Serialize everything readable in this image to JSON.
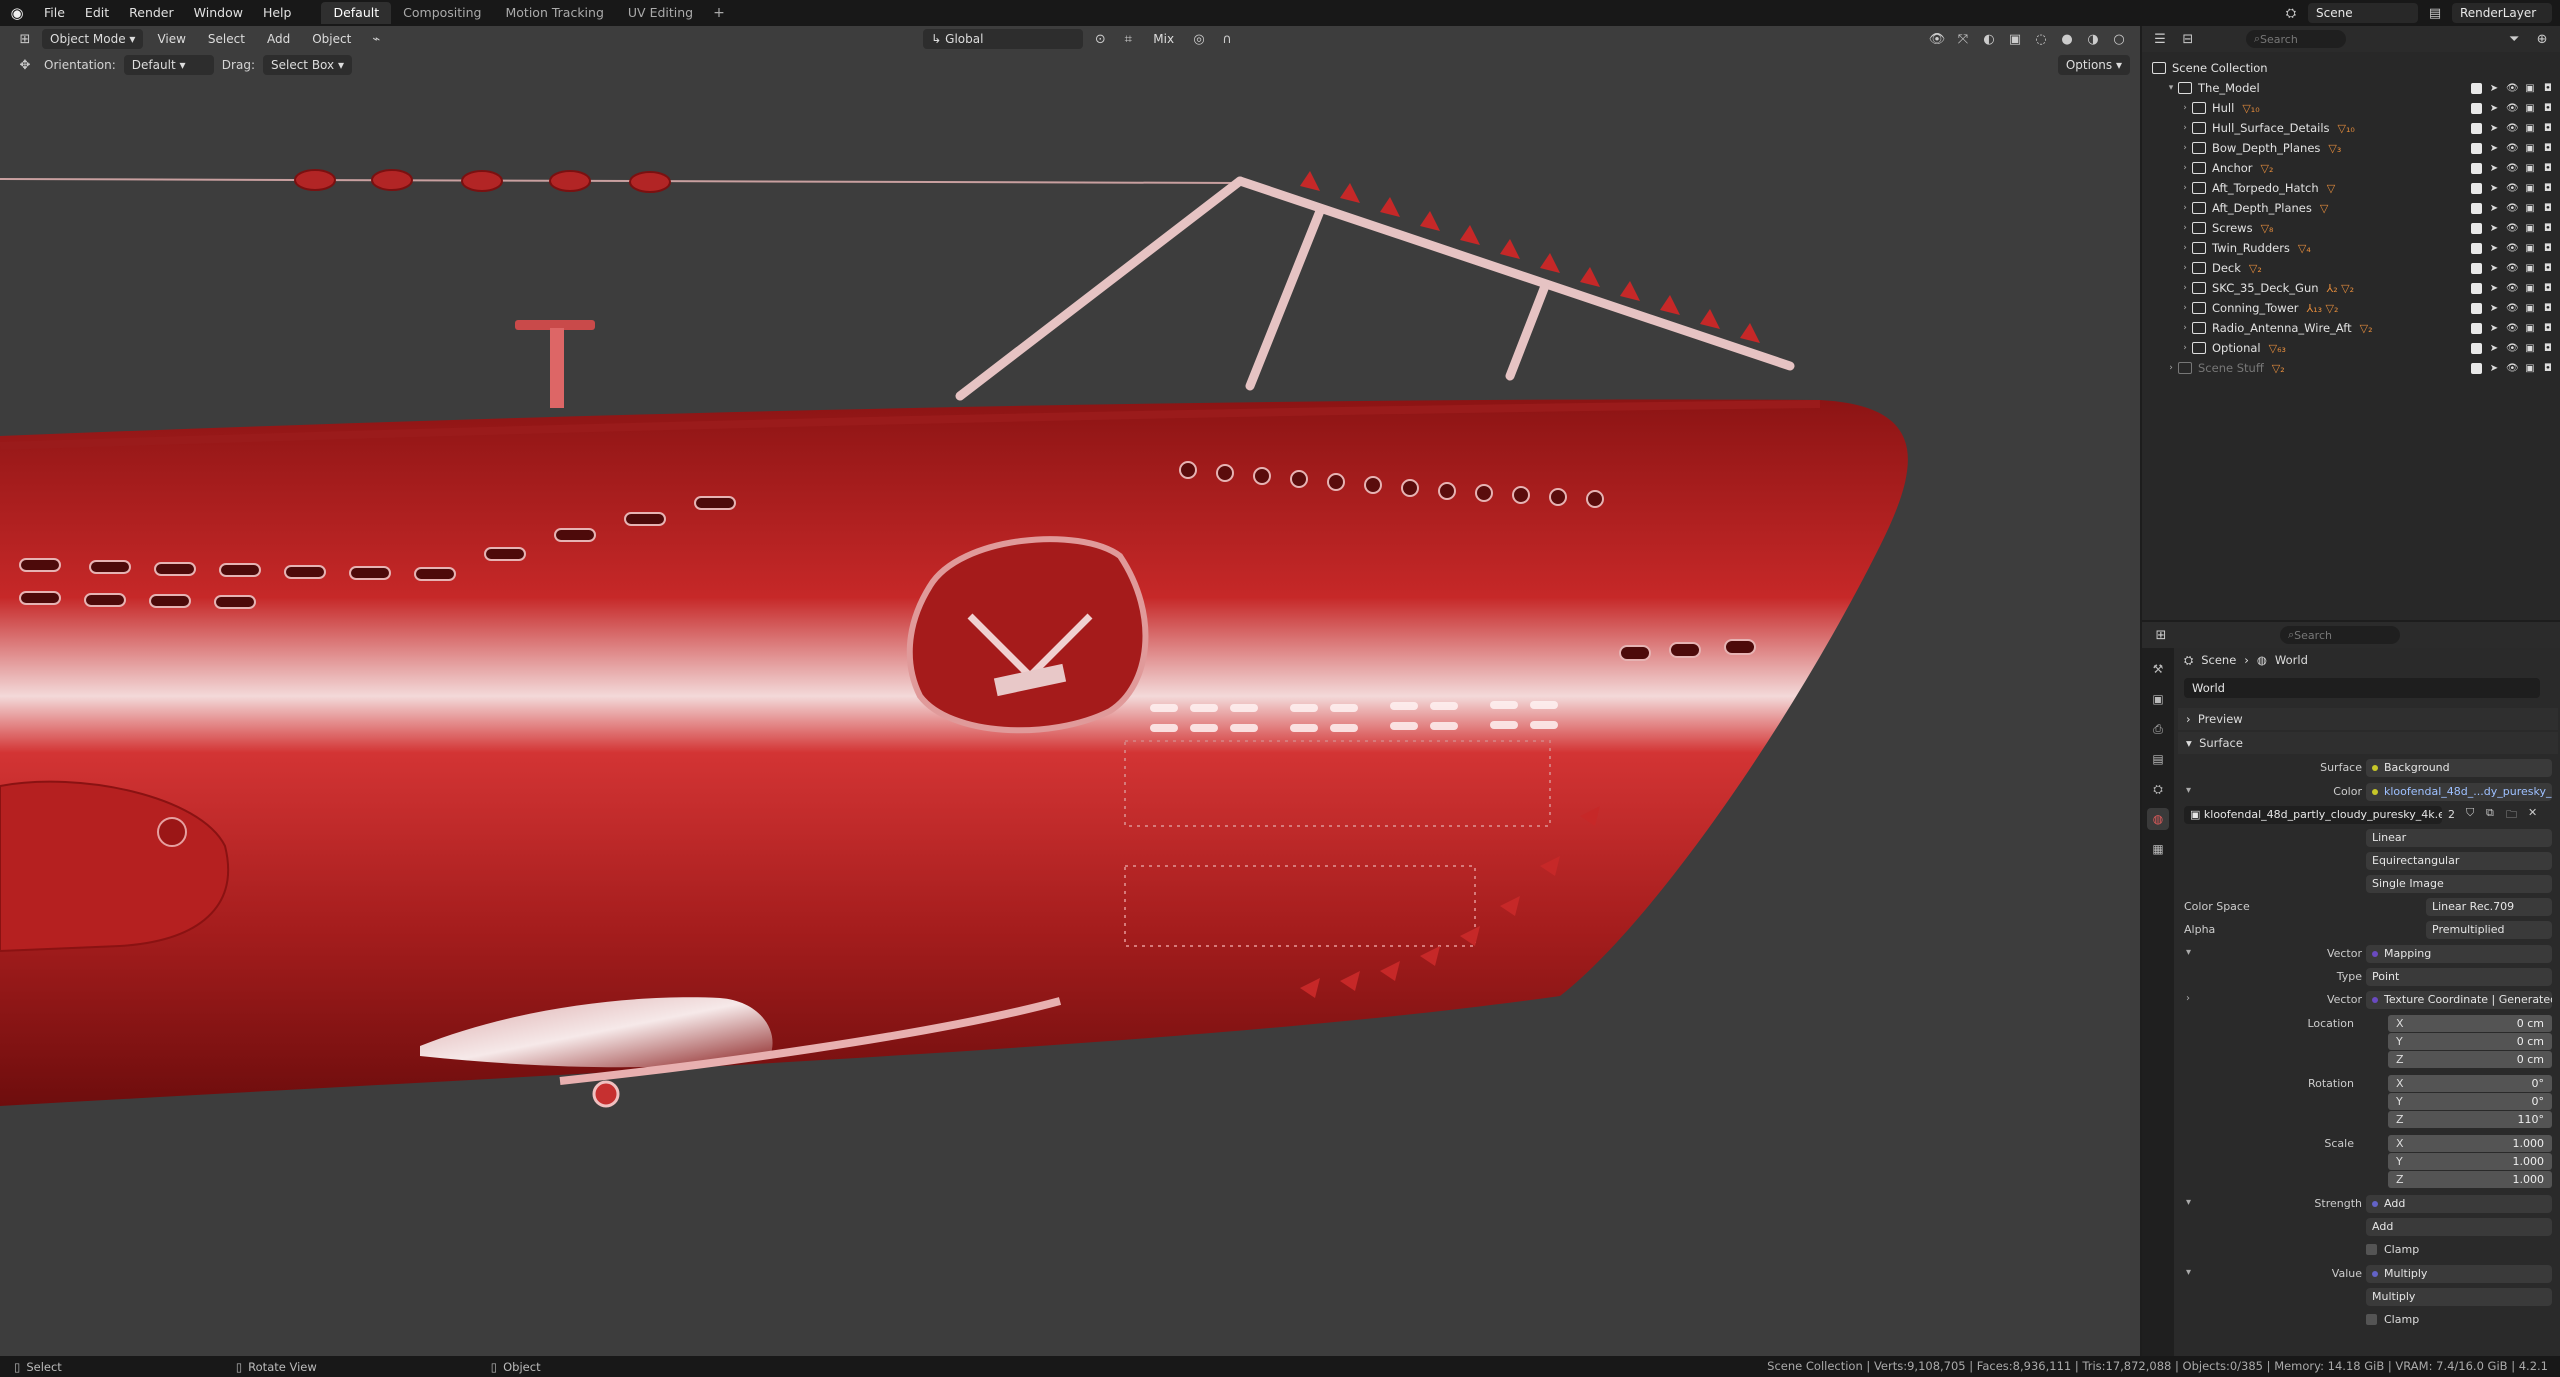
{
  "menu": [
    "File",
    "Edit",
    "Render",
    "Window",
    "Help"
  ],
  "workspaces": [
    {
      "label": "Default",
      "active": true
    },
    {
      "label": "Compositing",
      "active": false
    },
    {
      "label": "Motion Tracking",
      "active": false
    },
    {
      "label": "UV Editing",
      "active": false
    }
  ],
  "top_right": {
    "scene": "Scene",
    "view_layer": "RenderLayer"
  },
  "viewport": {
    "mode": "Object Mode",
    "menus": [
      "View",
      "Select",
      "Add",
      "Object"
    ],
    "transform_orientation": "Global",
    "snap_label": "Mix",
    "orientation_label": "Orientation:",
    "orientation_value": "Default",
    "drag_label": "Drag:",
    "drag_value": "Select Box",
    "options": "Options"
  },
  "outliner": {
    "search_placeholder": "Search",
    "root": "Scene Collection",
    "collection": "The_Model",
    "items": [
      {
        "name": "Hull",
        "mod": "▽₁₀"
      },
      {
        "name": "Hull_Surface_Details",
        "mod": "▽₁₀"
      },
      {
        "name": "Bow_Depth_Planes",
        "mod": "▽₃"
      },
      {
        "name": "Anchor",
        "mod": "▽₂"
      },
      {
        "name": "Aft_Torpedo_Hatch",
        "mod": "▽"
      },
      {
        "name": "Aft_Depth_Planes",
        "mod": "▽"
      },
      {
        "name": "Screws",
        "mod": "▽₈"
      },
      {
        "name": "Twin_Rudders",
        "mod": "▽₄"
      },
      {
        "name": "Deck",
        "mod": "▽₂"
      },
      {
        "name": "SKC_35_Deck_Gun",
        "mod": "⅄₂ ▽₂"
      },
      {
        "name": "Conning_Tower",
        "mod": "⅄₁₃ ▽₂"
      },
      {
        "name": "Radio_Antenna_Wire_Aft",
        "mod": "▽₂"
      },
      {
        "name": "Optional",
        "mod": "▽₆₃"
      }
    ],
    "scene_stuff": "Scene Stuff"
  },
  "properties": {
    "search_placeholder": "Search",
    "breadcrumb": [
      "Scene",
      "World"
    ],
    "world_name": "World",
    "panels": {
      "preview": "Preview",
      "surface": "Surface"
    },
    "surface": {
      "label": "Surface",
      "value": "Background"
    },
    "color": {
      "label": "Color",
      "value": "kloofendal_48d_...dy_puresky_4k.exr"
    },
    "image": {
      "name": "kloofendal_48d_partly_cloudy_puresky_4k.e...",
      "users": "2"
    },
    "interpolation": "Linear",
    "projection": "Equirectangular",
    "source": "Single Image",
    "color_space": {
      "label": "Color Space",
      "value": "Linear Rec.709"
    },
    "alpha": {
      "label": "Alpha",
      "value": "Premultiplied"
    },
    "vector": {
      "label": "Vector",
      "value": "Mapping"
    },
    "type": {
      "label": "Type",
      "value": "Point"
    },
    "vector2": {
      "label": "Vector",
      "value": "Texture Coordinate | Generated"
    },
    "location": {
      "label": "Location",
      "x": "0 cm",
      "y": "0 cm",
      "z": "0 cm"
    },
    "rotation": {
      "label": "Rotation",
      "x": "0°",
      "y": "0°",
      "z": "110°"
    },
    "scale": {
      "label": "Scale",
      "x": "1.000",
      "y": "1.000",
      "z": "1.000"
    },
    "strength": {
      "label": "Strength",
      "value": "Add",
      "op": "Add",
      "clamp": "Clamp"
    },
    "value": {
      "label": "Value",
      "value": "Multiply",
      "op": "Multiply",
      "clamp": "Clamp"
    }
  },
  "statusbar": {
    "select": "Select",
    "rotate": "Rotate View",
    "object": "Object",
    "stats": "Scene Collection | Verts:9,108,705 | Faces:8,936,111 | Tris:17,872,088 | Objects:0/385 | Memory: 14.18 GiB | VRAM: 7.4/16.0 GiB | 4.2.1"
  },
  "colors": {
    "accent": "#4772b3",
    "hull": "#b71c1c",
    "modifier": "#e08a3c",
    "world_tab": "#e25b5b"
  }
}
